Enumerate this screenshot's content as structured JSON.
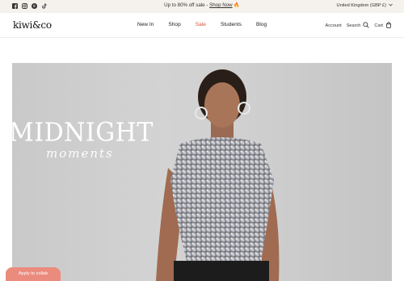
{
  "announcement": {
    "text": "Up to 80% off sale - ",
    "link": "Shop Now",
    "emoji": "🔥",
    "locale": "United Kingdom (GBP £)"
  },
  "social_icons": [
    "facebook-icon",
    "instagram-icon",
    "pinterest-icon",
    "tiktok-icon"
  ],
  "header": {
    "logo": "kiwi&co",
    "nav": [
      "New In",
      "Shop",
      "Sale",
      "Students",
      "Blog"
    ],
    "account": "Account",
    "search": "Search",
    "cart": "Cart"
  },
  "hero": {
    "title": "MIDNIGHT",
    "subtitle": "moments"
  },
  "cookie": {
    "label": "Apply to collab"
  },
  "colors": {
    "announcement_bg": "#f5f1ec",
    "sale_accent": "#d4563e",
    "cookie_button": "#ea8b7d",
    "hero_bg": "#cfcfcf"
  }
}
